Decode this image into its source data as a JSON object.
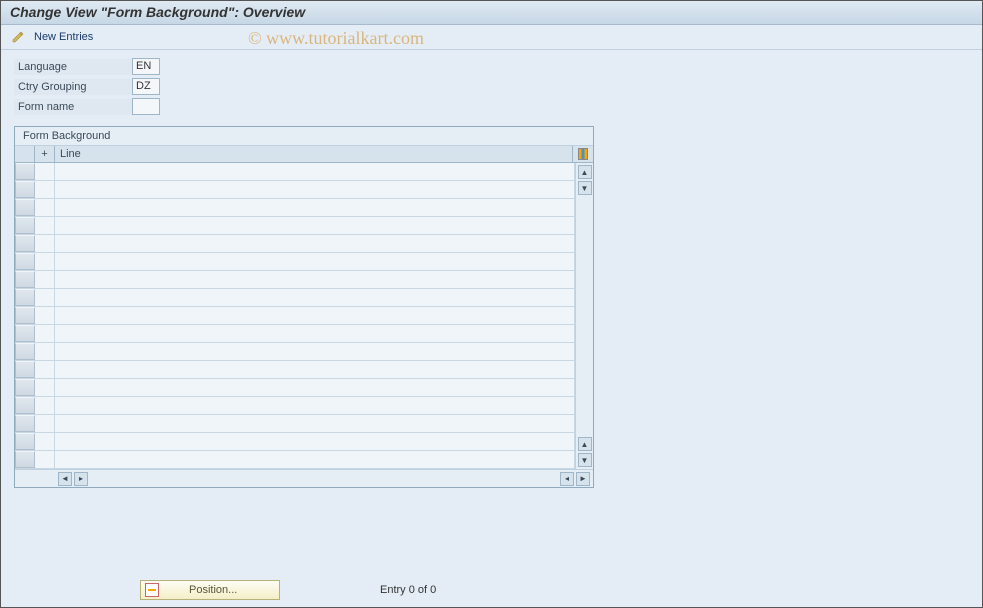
{
  "title": "Change View \"Form Background\": Overview",
  "toolbar": {
    "new_entries_label": "New Entries"
  },
  "fields": {
    "language_label": "Language",
    "language_value": "EN",
    "ctry_grouping_label": "Ctry Grouping",
    "ctry_grouping_value": "DZ",
    "form_name_label": "Form name",
    "form_name_value": ""
  },
  "grid": {
    "title": "Form Background",
    "col_plus": "+",
    "col_line": "Line",
    "row_count": 17
  },
  "footer": {
    "position_label": "Position...",
    "entry_text": "Entry 0 of 0"
  },
  "watermark": "© www.tutorialkart.com"
}
